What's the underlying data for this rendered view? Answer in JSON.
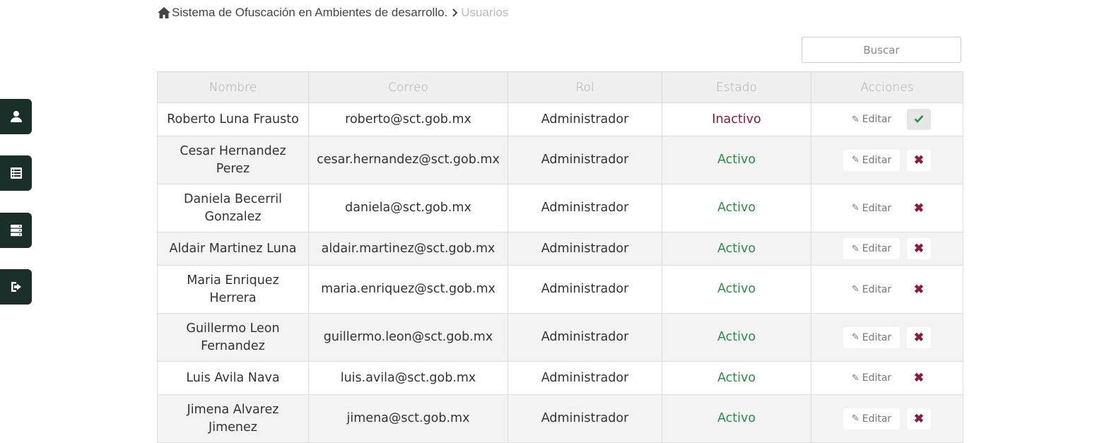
{
  "breadcrumb": {
    "main": "Sistema de Ofuscación en Ambientes de desarrollo.",
    "current": "Usuarios"
  },
  "search": {
    "placeholder": "Buscar"
  },
  "sidebar": {
    "items": [
      {
        "icon": "user-icon"
      },
      {
        "icon": "list-icon"
      },
      {
        "icon": "server-icon"
      },
      {
        "icon": "logout-icon"
      }
    ]
  },
  "table": {
    "headers": [
      "Nombre",
      "Correo",
      "Rol",
      "Estado",
      "Acciones"
    ],
    "edit_label": "Editar",
    "rows": [
      {
        "name": "Roberto Luna Frausto",
        "email": "roberto@sct.gob.mx",
        "role": "Administrador",
        "status": "Inactivo",
        "action": "activate"
      },
      {
        "name": "Cesar Hernandez Perez",
        "email": "cesar.hernandez@sct.gob.mx",
        "role": "Administrador",
        "status": "Activo",
        "action": "deactivate"
      },
      {
        "name": "Daniela Becerril Gonzalez",
        "email": "daniela@sct.gob.mx",
        "role": "Administrador",
        "status": "Activo",
        "action": "deactivate"
      },
      {
        "name": "Aldair Martinez Luna",
        "email": "aldair.martinez@sct.gob.mx",
        "role": "Administrador",
        "status": "Activo",
        "action": "deactivate"
      },
      {
        "name": "Maria Enriquez Herrera",
        "email": "maria.enriquez@sct.gob.mx",
        "role": "Administrador",
        "status": "Activo",
        "action": "deactivate"
      },
      {
        "name": "Guillermo Leon Fernandez",
        "email": "guillermo.leon@sct.gob.mx",
        "role": "Administrador",
        "status": "Activo",
        "action": "deactivate"
      },
      {
        "name": "Luis Avila Nava",
        "email": "luis.avila@sct.gob.mx",
        "role": "Administrador",
        "status": "Activo",
        "action": "deactivate"
      },
      {
        "name": "Jimena Alvarez Jimenez",
        "email": "jimena@sct.gob.mx",
        "role": "Administrador",
        "status": "Activo",
        "action": "deactivate"
      }
    ]
  },
  "colors": {
    "sidebar_bg": "#1b2f2a",
    "active": "#2e8b47",
    "inactive": "#8b1a3c"
  }
}
